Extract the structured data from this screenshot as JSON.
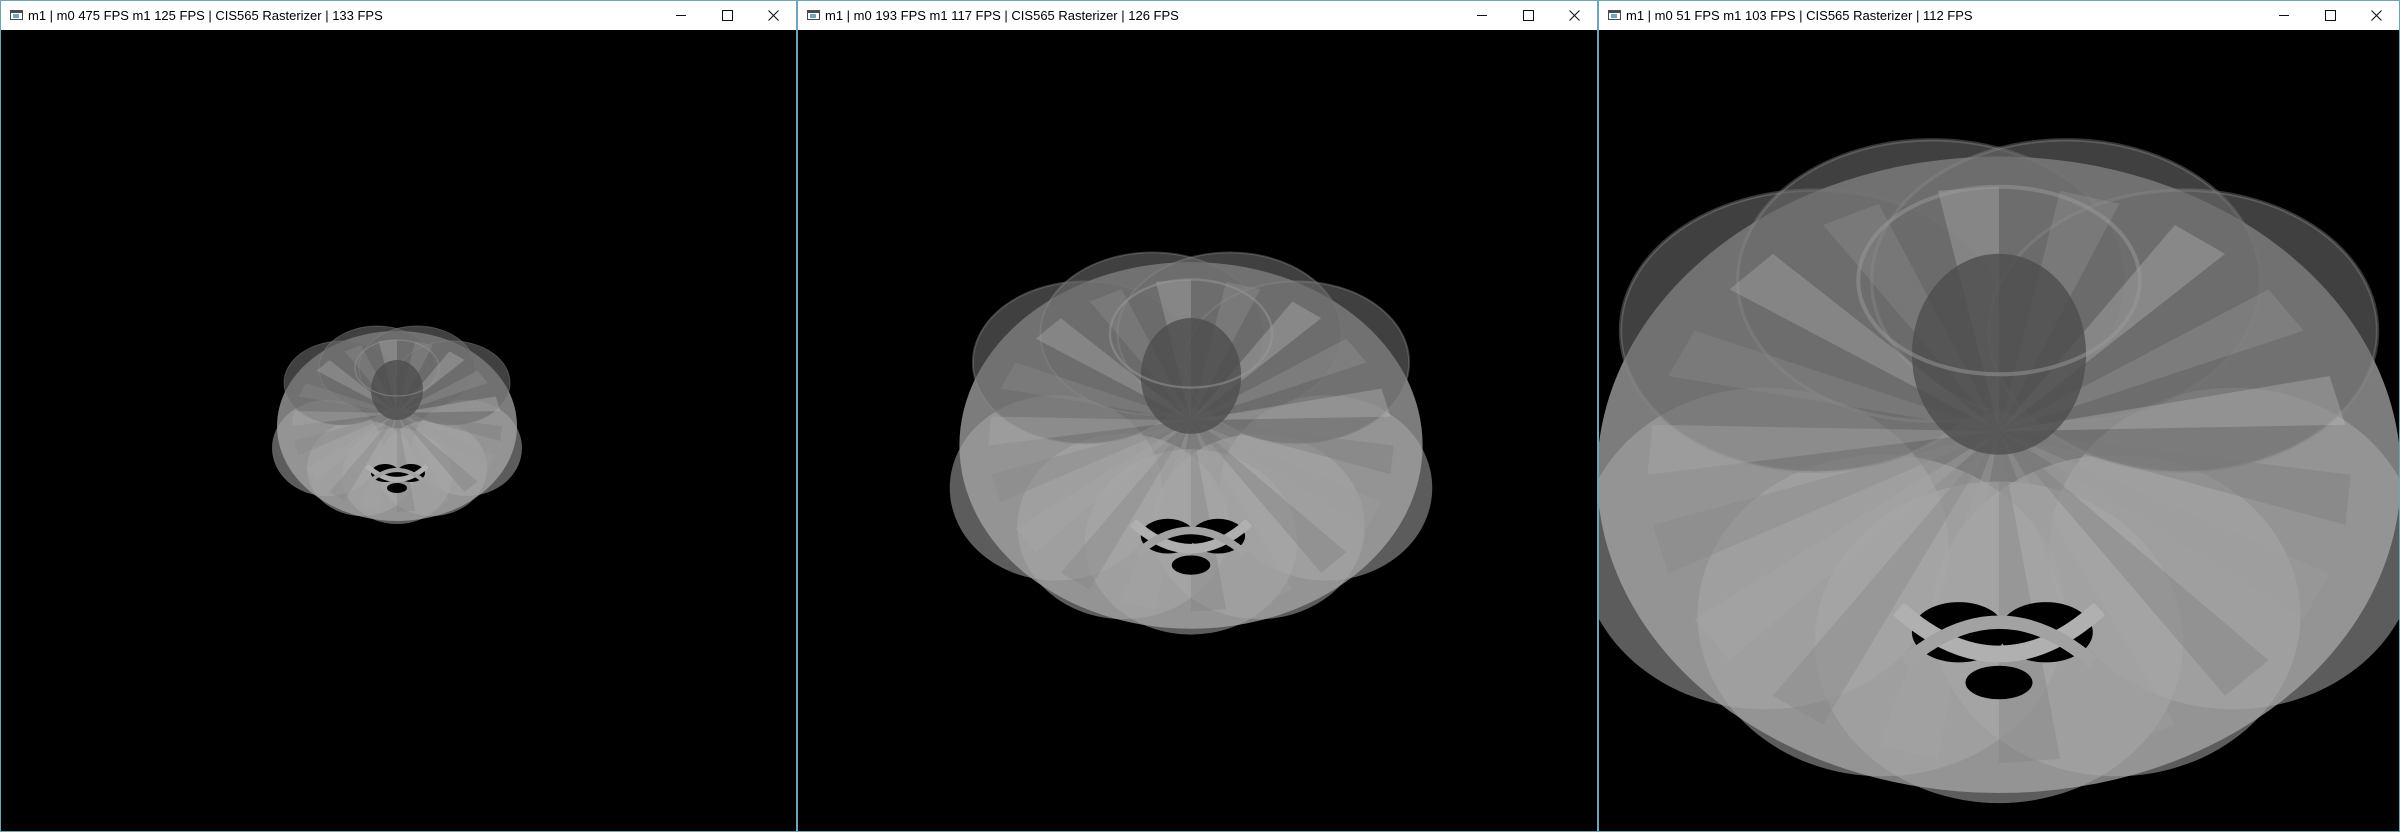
{
  "windows": [
    {
      "title": "m1 | m0 475 FPS m1 125 FPS | CIS565 Rasterizer | 133 FPS",
      "render": "small"
    },
    {
      "title": "m1 | m0 193 FPS m1 117 FPS | CIS565 Rasterizer | 126 FPS",
      "render": "medium"
    },
    {
      "title": "m1 | m0 51 FPS m1 103 FPS | CIS565 Rasterizer | 112 FPS",
      "render": "large"
    }
  ],
  "icons": {
    "app": "app-window-icon",
    "minimize": "minimize-icon",
    "maximize": "maximize-icon",
    "close": "close-icon"
  },
  "colors": {
    "titlebar_bg": "#ffffff",
    "window_border": "#6fa3b8",
    "viewport_bg": "#000000",
    "mesh_shade": "#9a9a9a"
  }
}
